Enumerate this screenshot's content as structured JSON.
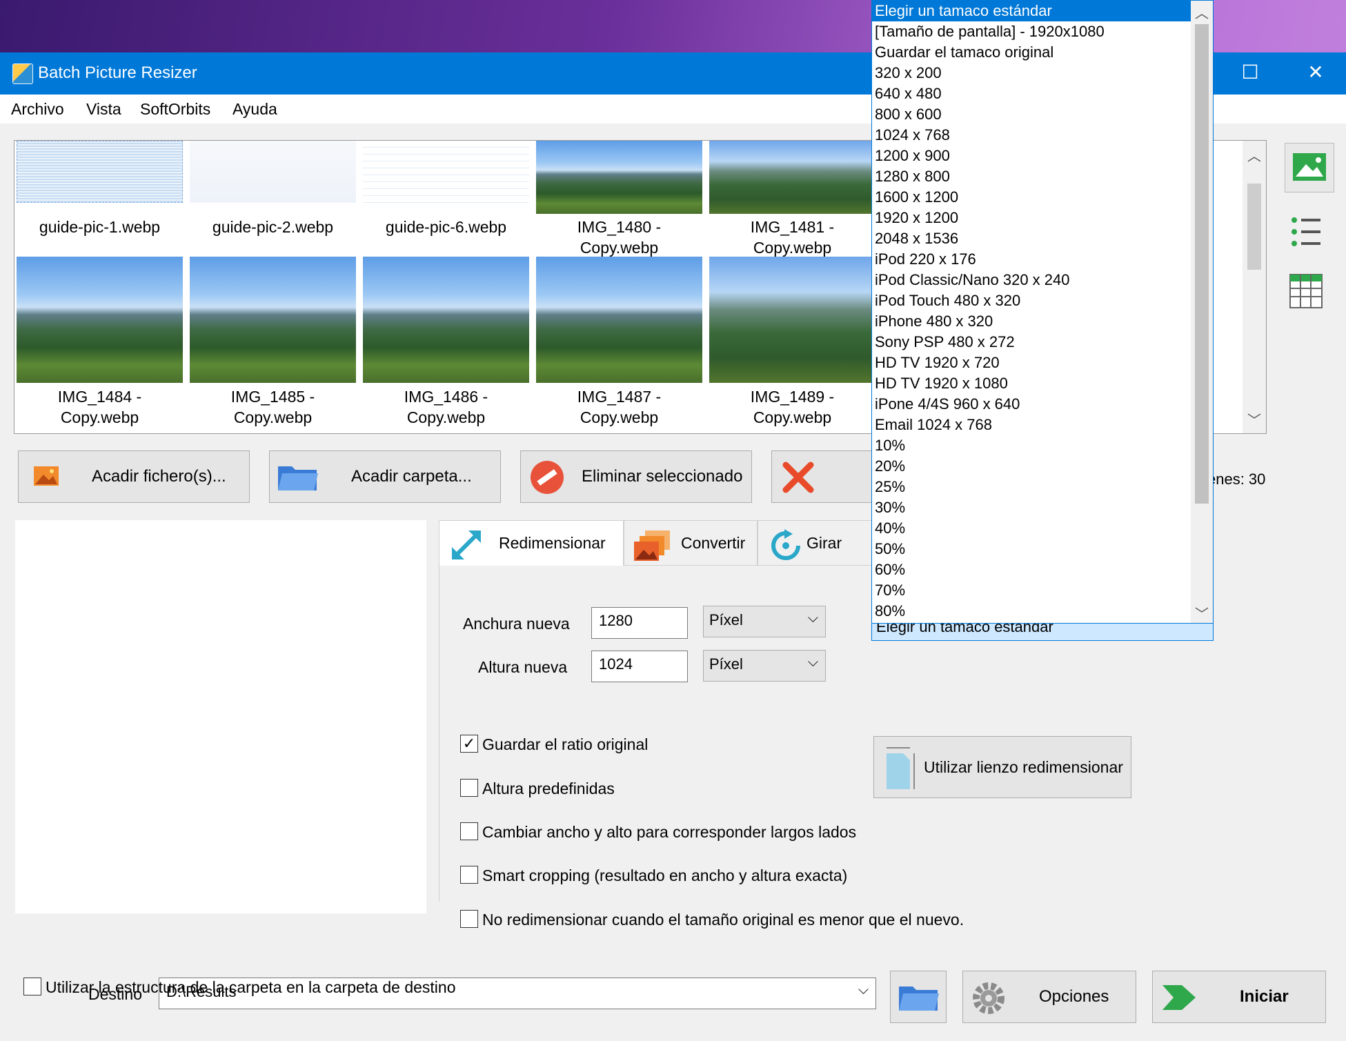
{
  "window": {
    "title": "Batch Picture Resizer",
    "maximize_glyph": "☐",
    "close_glyph": "✕"
  },
  "menu": [
    "Archivo",
    "Vista",
    "SoftOrbits",
    "Ayuda"
  ],
  "gallery": {
    "row1": [
      {
        "name": "guide-pic-1.webp",
        "style": "guide1"
      },
      {
        "name": "guide-pic-2.webp",
        "style": "guide2"
      },
      {
        "name": "guide-pic-6.webp",
        "style": "guide6"
      },
      {
        "name": "IMG_1480 -\nCopy.webp",
        "style": "mtn"
      },
      {
        "name": "IMG_1481 -\nCopy.webp",
        "style": "mtn2"
      }
    ],
    "row2": [
      {
        "name": "IMG_1484 -\nCopy.webp",
        "style": "mtn"
      },
      {
        "name": "IMG_1485 -\nCopy.webp",
        "style": "mtn"
      },
      {
        "name": "IMG_1486 -\nCopy.webp",
        "style": "mtn"
      },
      {
        "name": "IMG_1487 -\nCopy.webp",
        "style": "mtn"
      },
      {
        "name": "IMG_1489 -\nCopy.webp",
        "style": "mtn2"
      }
    ],
    "up_arrow": "︿",
    "down_arrow": "﹀"
  },
  "buttons": {
    "add_files": "Acadir fichero(s)...",
    "add_folder": "Acadir carpeta...",
    "remove_selected": "Eliminar seleccionado",
    "images_count": "enes: 30"
  },
  "tabs": [
    {
      "label": "Redimensionar",
      "icon": "resize-arrows-icon"
    },
    {
      "label": "Convertir",
      "icon": "convert-photos-icon"
    },
    {
      "label": "Girar",
      "icon": "rotate-icon"
    }
  ],
  "resize": {
    "width_label": "Anchura nueva",
    "width_value": "1280",
    "height_label": "Altura nueva",
    "height_value": "1024",
    "unit": "Píxel",
    "checkboxes": [
      {
        "label": "Guardar el ratio original",
        "checked": true
      },
      {
        "label": "Altura predefinidas",
        "checked": false
      },
      {
        "label": "Cambiar ancho y alto para corresponder largos lados",
        "checked": false
      },
      {
        "label": "Smart cropping (resultado en ancho y altura exacta)",
        "checked": false
      },
      {
        "label": "No redimensionar cuando el tamaño original es menor que el nuevo.",
        "checked": false
      }
    ],
    "canvas_button": "Utilizar lienzo redimensionar",
    "standard_size_current": "Elegir un tamaco estándar"
  },
  "dropdown": {
    "items": [
      "Elegir un tamaco estándar",
      "[Tamaño de pantalla] - 1920x1080",
      "Guardar el tamaco original",
      "320 x 200",
      "640 x 480",
      "800 x 600",
      "1024 x 768",
      "1200 x 900",
      "1280 x 800",
      "1600 x 1200",
      "1920 x 1200",
      "2048 x 1536",
      "iPod 220 x 176",
      "iPod Classic/Nano 320 x 240",
      "iPod Touch 480 x 320",
      "iPhone 480 x 320",
      "Sony PSP 480 x 272",
      "HD TV 1920 x 720",
      "HD TV 1920 x 1080",
      "iPone 4/4S 960 x 640",
      "Email 1024 x 768",
      "10%",
      "20%",
      "25%",
      "30%",
      "40%",
      "50%",
      "60%",
      "70%",
      "80%"
    ],
    "selected_index": 0
  },
  "destination": {
    "label": "Destino",
    "value": "D:\\Results",
    "options_button": "Opciones",
    "start_button": "Iniciar",
    "use_structure": "Utilizar la estructura de la carpeta en la carpeta de destino",
    "use_structure_checked": false
  },
  "colors": {
    "accent": "#0078d7",
    "remove_red": "#e8523a",
    "start_green": "#2ea84a"
  }
}
